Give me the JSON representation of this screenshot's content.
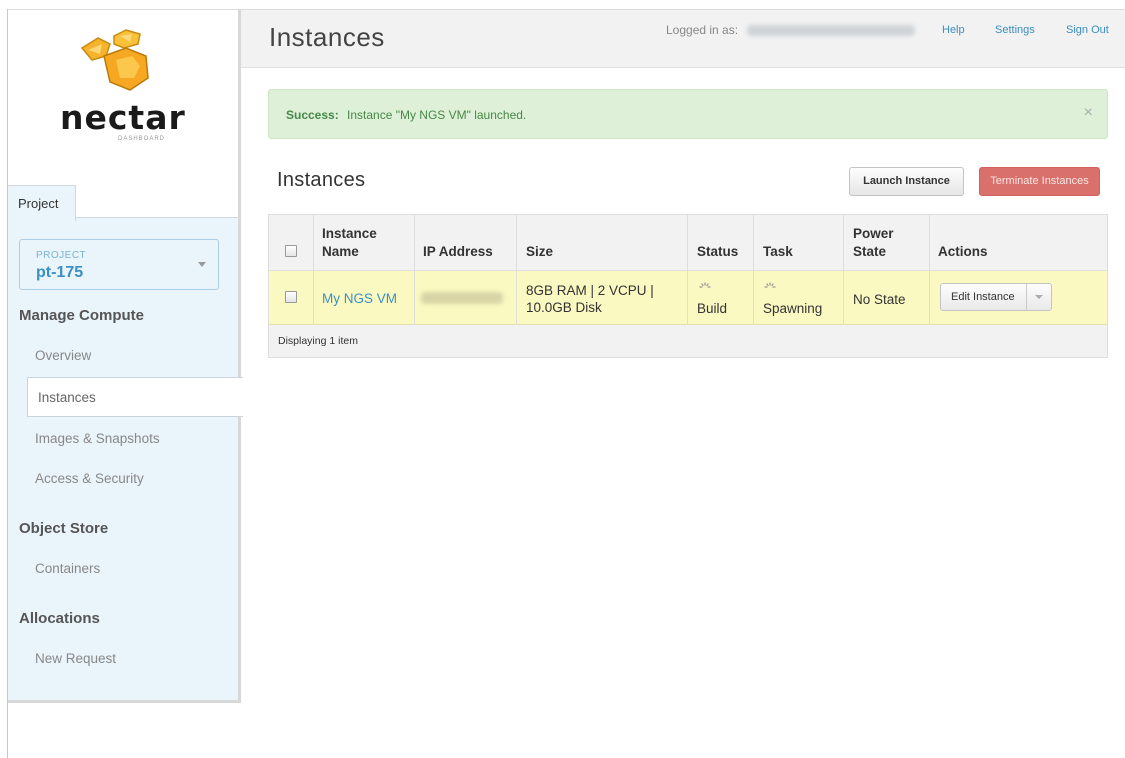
{
  "brand": {
    "name": "nectar",
    "sub": "DASHBOARD"
  },
  "header": {
    "title": "Instances",
    "logged_in_label": "Logged in as:",
    "links": [
      "Help",
      "Settings",
      "Sign Out"
    ]
  },
  "sidebar": {
    "tab": "Project",
    "project_label": "PROJECT",
    "project_value": "pt-175",
    "sections": [
      {
        "title": "Manage Compute",
        "items": [
          "Overview",
          "Instances",
          "Images & Snapshots",
          "Access & Security"
        ]
      },
      {
        "title": "Object Store",
        "items": [
          "Containers"
        ]
      },
      {
        "title": "Allocations",
        "items": [
          "New Request"
        ]
      }
    ],
    "active_item": "Instances"
  },
  "alert": {
    "strong": "Success:",
    "message": "Instance \"My NGS VM\" launched.",
    "close": "×"
  },
  "content": {
    "title": "Instances",
    "launch_button": "Launch Instance",
    "terminate_button": "Terminate Instances"
  },
  "table": {
    "headers": [
      "Instance Name",
      "IP Address",
      "Size",
      "Status",
      "Task",
      "Power State",
      "Actions"
    ],
    "rows": [
      {
        "name": "My NGS VM",
        "size_line1": "8GB RAM | 2 VCPU |",
        "size_line2": "10.0GB Disk",
        "status": "Build",
        "task": "Spawning",
        "power_state": "No State",
        "action": "Edit Instance"
      }
    ],
    "footer": "Displaying 1 item"
  },
  "colors": {
    "sidebar_bg": "#eaf4fb",
    "link": "#3b8fc2",
    "alert_bg": "#dff0d8",
    "alert_text": "#468847",
    "row_highlight": "#fbf9c2",
    "danger": "#d9706b"
  }
}
